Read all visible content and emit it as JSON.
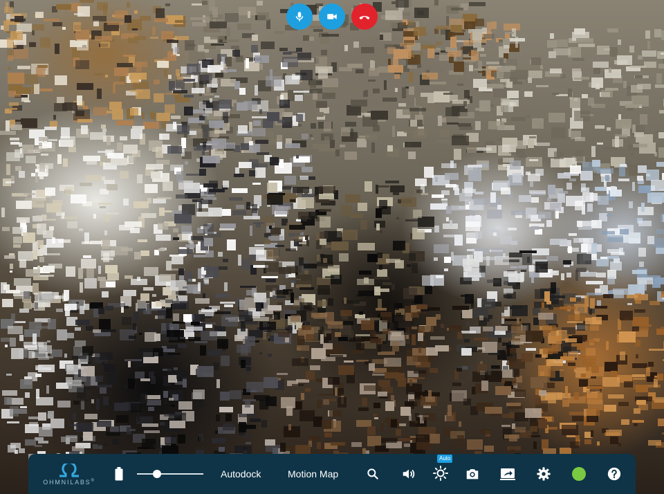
{
  "call_controls": {
    "mic": {
      "icon": "microphone-icon",
      "color": "#1e9fe0"
    },
    "camera": {
      "icon": "video-camera-icon",
      "color": "#1e9fe0"
    },
    "hangup": {
      "icon": "phone-hangup-icon",
      "color": "#e2232c"
    }
  },
  "toolbar": {
    "background": "#0f3447",
    "logo_text": "OHMNILABS",
    "logo_mark": "®",
    "battery_icon": "battery-icon",
    "speed_slider": {
      "value": 0.3
    },
    "autodock_label": "Autodock",
    "motion_map_label": "Motion Map",
    "search_icon": "search-icon",
    "volume_icon": "volume-icon",
    "brightness_icon": "brightness-icon",
    "brightness_badge": "Auto",
    "camera_icon": "camera-icon",
    "share_icon": "screen-share-icon",
    "settings_icon": "gear-icon",
    "status": {
      "color": "#7ac943"
    },
    "help_icon": "help-icon"
  }
}
